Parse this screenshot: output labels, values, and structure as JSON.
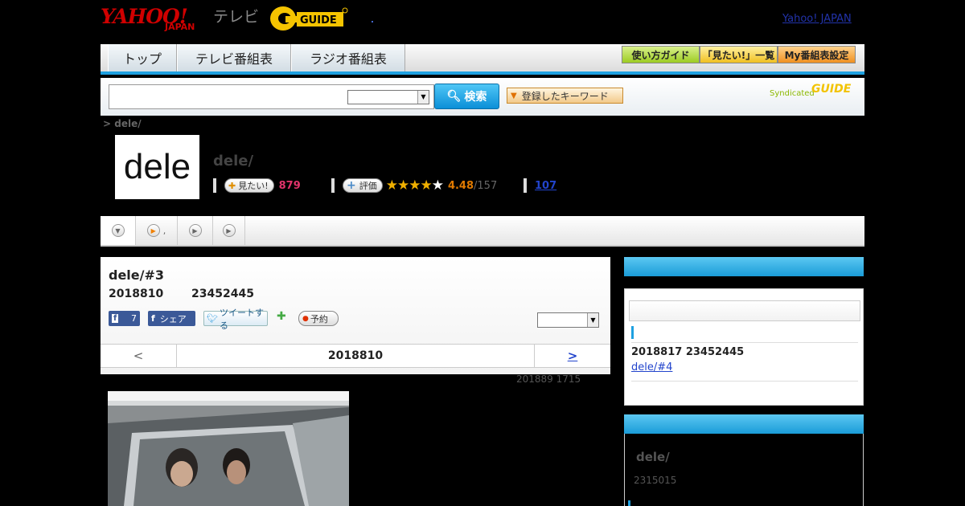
{
  "header": {
    "logo_yahoo": "YAHOO!",
    "logo_japan": "JAPAN",
    "logo_tv": "テレビ",
    "logo_gguide": "G-GUIDE",
    "top_link": "Yahoo! JAPAN"
  },
  "nav": {
    "tabs": [
      {
        "label": "トップ"
      },
      {
        "label": "テレビ番組表"
      },
      {
        "label": "ラジオ番組表"
      }
    ],
    "guide_buttons": [
      {
        "label": "使い方ガイド",
        "color": "#b8e04a"
      },
      {
        "label": "「見たい!」一覧",
        "color": "#ffd84a"
      },
      {
        "label": "My番組表設定",
        "color": "#ffb24a"
      }
    ]
  },
  "search": {
    "input_value": "",
    "select_value": "",
    "button_label": "検索",
    "keyword_button": "登録したキーワード",
    "syndicated": "Syndicated",
    "syndicated_logo": "GUIDE"
  },
  "breadcrumb": "> dele/",
  "program": {
    "image_text": "dele",
    "title": "dele/",
    "want_label": "見たい!",
    "want_count": "879",
    "rate_label": "評価",
    "rating_value": "4.48",
    "rating_count": "/157",
    "review_link": "107"
  },
  "tabstrip": {
    "tab2_text": ","
  },
  "episode": {
    "title": "dele/#3",
    "date": "2018810",
    "time": "23452445",
    "fb_like_count": "7",
    "fb_share": "シェア",
    "tweet": "ツイートする",
    "reserve": "予約",
    "select_value": "",
    "pager_prev": "<",
    "pager_current": "2018810",
    "pager_next": ">",
    "updated": "201889  1715"
  },
  "sidebar": {
    "box1": {
      "input_value": "",
      "next_date": "2018817  23452445",
      "next_link": "dele/#4"
    },
    "box2": {
      "title": "dele/",
      "date": "2315015"
    }
  },
  "colors": {
    "accent_blue": "#1ea0e0",
    "want_red": "#e0336a",
    "rating_orange": "#e07a00",
    "star_gold": "#f0b000",
    "link_blue": "#2244cc"
  }
}
